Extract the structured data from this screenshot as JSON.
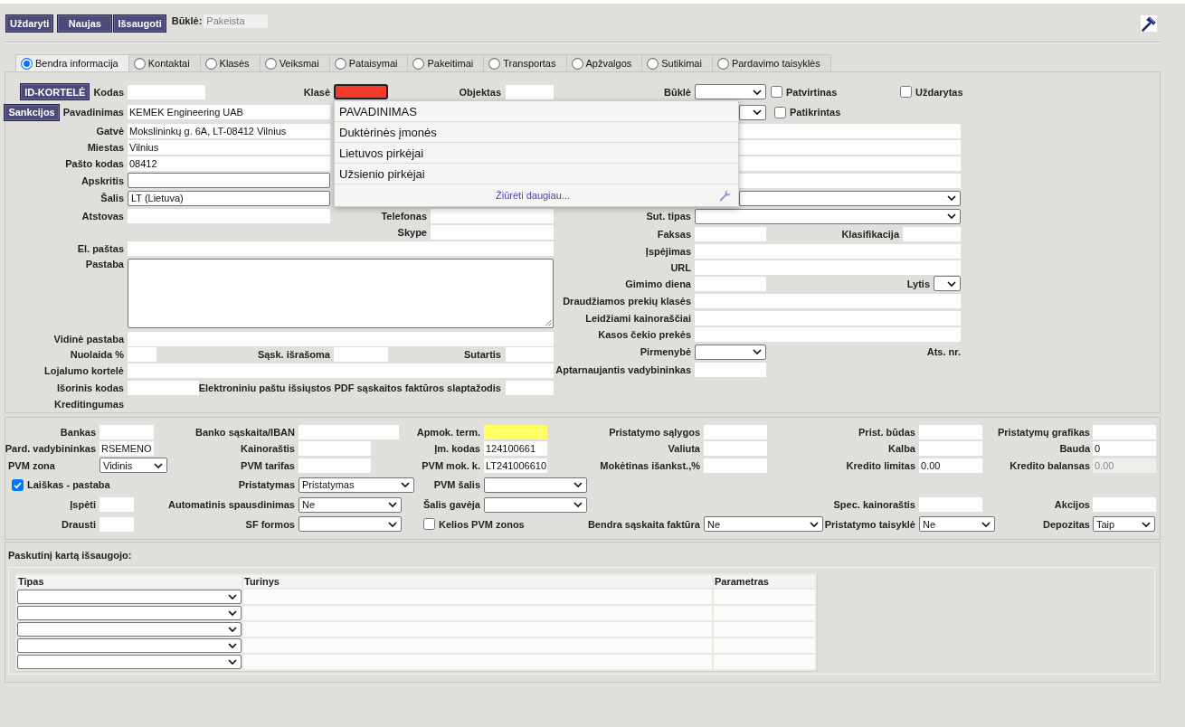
{
  "toolbar": {
    "buttons": [
      "Uždaryti",
      "Naujas",
      "Išsaugoti"
    ],
    "status_label": "Būklė:",
    "status_value": "Pakeista"
  },
  "tabs": [
    {
      "label": "Bendra informacija",
      "selected": true
    },
    {
      "label": "Kontaktai",
      "selected": false
    },
    {
      "label": "Klasės",
      "selected": false
    },
    {
      "label": "Veiksmai",
      "selected": false
    },
    {
      "label": "Pataisymai",
      "selected": false
    },
    {
      "label": "Pakeitimai",
      "selected": false
    },
    {
      "label": "Transportas",
      "selected": false
    },
    {
      "label": "Apžvalgos",
      "selected": false
    },
    {
      "label": "Sutikimai",
      "selected": false
    },
    {
      "label": "Pardavimo taisyklės",
      "selected": false
    }
  ],
  "general": {
    "left": [
      {
        "button": "ID-KORTELĖ",
        "label": "Kodas",
        "kind": "text"
      },
      {
        "label": "Klasė",
        "kind": "text",
        "color": "#f43a2b",
        "dropdown": {
          "options": [
            "PAVADINIMAS",
            "Duktėrinės įmonės",
            "Lietuvos pirkėjai",
            "Užsienio pirkėjai"
          ],
          "more_link": "Žiūrėti daugiau..."
        }
      },
      {
        "label": "Objektas",
        "kind": "text"
      },
      {
        "button": "Sankcijos",
        "label": "Pavadinimas",
        "kind": "text",
        "value": "KEMEK Engineering UAB"
      },
      {
        "label": "Gatvė",
        "kind": "text",
        "value": "Mokslininkų g. 6A, LT-08412 Vilnius"
      },
      {
        "label": "Miestas",
        "kind": "text",
        "value": "Vilnius"
      },
      {
        "label": "Pašto kodas",
        "kind": "text",
        "value": "08412"
      },
      {
        "label": "Apskritis",
        "kind": "box"
      },
      {
        "label": "Šalis",
        "kind": "box",
        "value": "LT (Lietuva)"
      },
      {
        "label": "Atstovas",
        "kind": "text"
      },
      {
        "label": "Telefonas",
        "kind": "text"
      },
      {
        "label": "Skype",
        "kind": "text"
      },
      {
        "label": "El. paštas",
        "kind": "text"
      },
      {
        "label": "Pastaba",
        "kind": "textarea"
      },
      {
        "label": "Vidinė pastaba",
        "kind": "text"
      },
      {
        "label": "Nuolaida %",
        "kind": "text"
      },
      {
        "label": "Sąsk. išrašoma",
        "kind": "text"
      },
      {
        "label": "Sutartis",
        "kind": "text"
      },
      {
        "label": "Lojalumo kortelė",
        "kind": "text"
      },
      {
        "label": "Išorinis kodas",
        "kind": "text"
      },
      {
        "label": "Elektroniniu paštu išsiųstos PDF sąskaitos faktūros slaptažodis",
        "kind": "text"
      },
      {
        "label": "Kreditingumas",
        "kind": "label"
      }
    ],
    "right": [
      {
        "label": "Būklė",
        "kind": "select"
      },
      {
        "label": "Patvirtinas",
        "kind": "checkbox",
        "checked": false
      },
      {
        "label": "Uždarytas",
        "kind": "checkbox",
        "checked": false
      },
      {
        "kind": "select"
      },
      {
        "label": "Patikrintas",
        "kind": "checkbox",
        "checked": false
      },
      {
        "kind": "text"
      },
      {
        "kind": "text"
      },
      {
        "kind": "text"
      },
      {
        "kind": "text"
      },
      {
        "kind": "select"
      },
      {
        "label": "Sut. tipas",
        "kind": "select"
      },
      {
        "label": "Faksas",
        "kind": "text"
      },
      {
        "label": "Klasifikacija",
        "kind": "text"
      },
      {
        "label": "Įspėjimas",
        "kind": "text"
      },
      {
        "label": "URL",
        "kind": "text"
      },
      {
        "label": "Gimimo diena",
        "kind": "text"
      },
      {
        "label": "Lytis",
        "kind": "select"
      },
      {
        "label": "Draudžiamos prekių klasės",
        "kind": "text"
      },
      {
        "label": "Leidžiami kainoraščiai",
        "kind": "text"
      },
      {
        "label": "Kasos čekio prekės",
        "kind": "text"
      },
      {
        "label": "Pirmenybė",
        "kind": "select"
      },
      {
        "label": "Ats. nr.",
        "kind": "label"
      },
      {
        "label": "Aptarnaujantis vadybininkas",
        "kind": "text"
      }
    ]
  },
  "details": [
    {
      "label": "Bankas",
      "kind": "text"
    },
    {
      "label": "Banko sąskaita/IBAN",
      "kind": "text"
    },
    {
      "label": "Apmok. term.",
      "kind": "text",
      "color": "#ffff66"
    },
    {
      "label": "Pristatymo sąlygos",
      "kind": "text"
    },
    {
      "label": "Prist. būdas",
      "kind": "text"
    },
    {
      "label": "Pristatymų grafikas",
      "kind": "text"
    },
    {
      "label": "Pard. vadybininkas",
      "kind": "text",
      "value": "RSEMENO"
    },
    {
      "label": "Kainoraštis",
      "kind": "text"
    },
    {
      "label": "Įm. kodas",
      "kind": "text",
      "value": "124100661"
    },
    {
      "label": "Valiuta",
      "kind": "text"
    },
    {
      "label": "Kalba",
      "kind": "text"
    },
    {
      "label": "Bauda",
      "kind": "text",
      "value": "0"
    },
    {
      "label": "PVM zona",
      "kind": "select",
      "value": "Vidinis"
    },
    {
      "label": "PVM tarifas",
      "kind": "text"
    },
    {
      "label": "PVM mok. k.",
      "kind": "text",
      "value": "LT241006610"
    },
    {
      "label": "Mokėtinas išankst.,%",
      "kind": "text"
    },
    {
      "label": "Kredito limitas",
      "kind": "text",
      "value": "0.00"
    },
    {
      "label": "Kredito balansas",
      "kind": "readonly",
      "value": "0.00"
    },
    {
      "label": "Laiškas - pastaba",
      "kind": "checkbox",
      "checked": true
    },
    {
      "label": "Pristatymas",
      "kind": "select",
      "value": "Pristatymas"
    },
    {
      "label": "PVM šalis",
      "kind": "select"
    },
    {
      "label": "Įspėti",
      "kind": "text"
    },
    {
      "label": "Automatinis spausdinimas",
      "kind": "select",
      "value": "Ne"
    },
    {
      "label": "Šalis gavėja",
      "kind": "select"
    },
    {
      "label": "Spec. kainoraštis",
      "kind": "text"
    },
    {
      "label": "Akcijos",
      "kind": "text"
    },
    {
      "label": "Drausti",
      "kind": "text"
    },
    {
      "label": "SF formos",
      "kind": "select"
    },
    {
      "label": "Kelios PVM zonos",
      "kind": "checkbox",
      "checked": false
    },
    {
      "label": "Bendra sąskaita faktūra",
      "kind": "select",
      "value": "Ne"
    },
    {
      "label": "Pristatymo taisyklė",
      "kind": "select",
      "value": "Ne"
    },
    {
      "label": "Depozitas",
      "kind": "select",
      "value": "Taip"
    }
  ],
  "last_saved": {
    "title": "Paskutinį kartą išsaugojo:",
    "columns": [
      "Tipas",
      "Turinys",
      "Parametras"
    ],
    "rows": [
      {
        "kind": "select"
      },
      {
        "kind": "select"
      },
      {
        "kind": "select"
      },
      {
        "kind": "select"
      },
      {
        "kind": "select"
      }
    ]
  }
}
